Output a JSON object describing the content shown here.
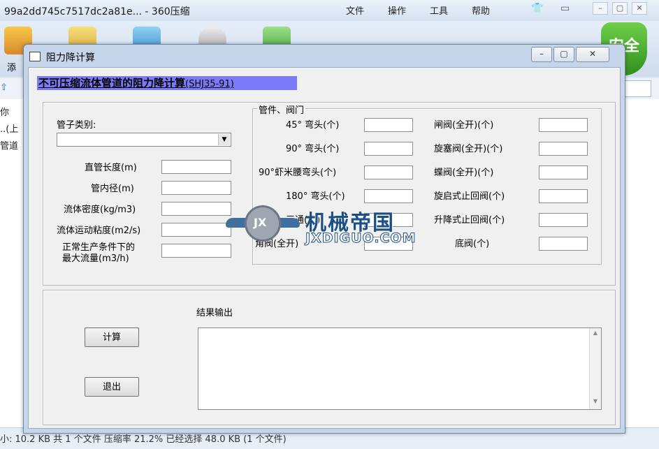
{
  "background": {
    "title": "99a2dd745c7517dc2a81e... - 360压缩",
    "menu": [
      "文件",
      "操作",
      "工具",
      "帮助"
    ],
    "toolbar_partial_label": "添",
    "shield_label": "安全",
    "list": [
      "你",
      "..(上",
      "管道"
    ],
    "status": "小: 10.2 KB 共 1 个文件 压缩率 21.2% 已经选择 48.0 KB (1 个文件)"
  },
  "dialog": {
    "title": "阻力降计算",
    "heading_main": "不可压缩流体管道的阻力降计算",
    "heading_code": "(SHJ35-91)",
    "pipe_type": {
      "label": "管子类别:",
      "value": ""
    },
    "pipe_params": [
      {
        "label": "直管长度(m)",
        "value": ""
      },
      {
        "label": "管内径(m)",
        "value": ""
      },
      {
        "label": "流体密度(kg/m3)",
        "value": ""
      },
      {
        "label": "流体运动粘度(m2/s)",
        "value": ""
      },
      {
        "label_line1": "正常生产条件下的",
        "label_line2": "最大流量(m3/h)",
        "value": ""
      }
    ],
    "fittings_group_title": "管件、阀门",
    "fittings_left": [
      {
        "label": "45° 弯头(个)",
        "value": ""
      },
      {
        "label": "90° 弯头(个)",
        "value": ""
      },
      {
        "label": "90°虾米腰弯头(个)",
        "value": ""
      },
      {
        "label": "180° 弯头(个)",
        "value": ""
      },
      {
        "label": "三通(个)",
        "value": ""
      },
      {
        "label": "角阀(全开)",
        "value": ""
      }
    ],
    "fittings_right": [
      {
        "label": "闸阀(全开)(个)",
        "value": ""
      },
      {
        "label": "旋塞阀(全开)(个)",
        "value": ""
      },
      {
        "label": "蝶阀(全开)(个)",
        "value": ""
      },
      {
        "label": "旋启式止回阀(个)",
        "value": ""
      },
      {
        "label": "升降式止回阀(个)",
        "value": ""
      },
      {
        "label": "底阀(个)",
        "value": ""
      }
    ],
    "result_label": "结果输出",
    "result_value": "",
    "calc_button": "计算",
    "exit_button": "退出"
  },
  "watermark": {
    "text": "机械帝国",
    "sub": "JXDIGUO.COM",
    "badge": "JX"
  }
}
